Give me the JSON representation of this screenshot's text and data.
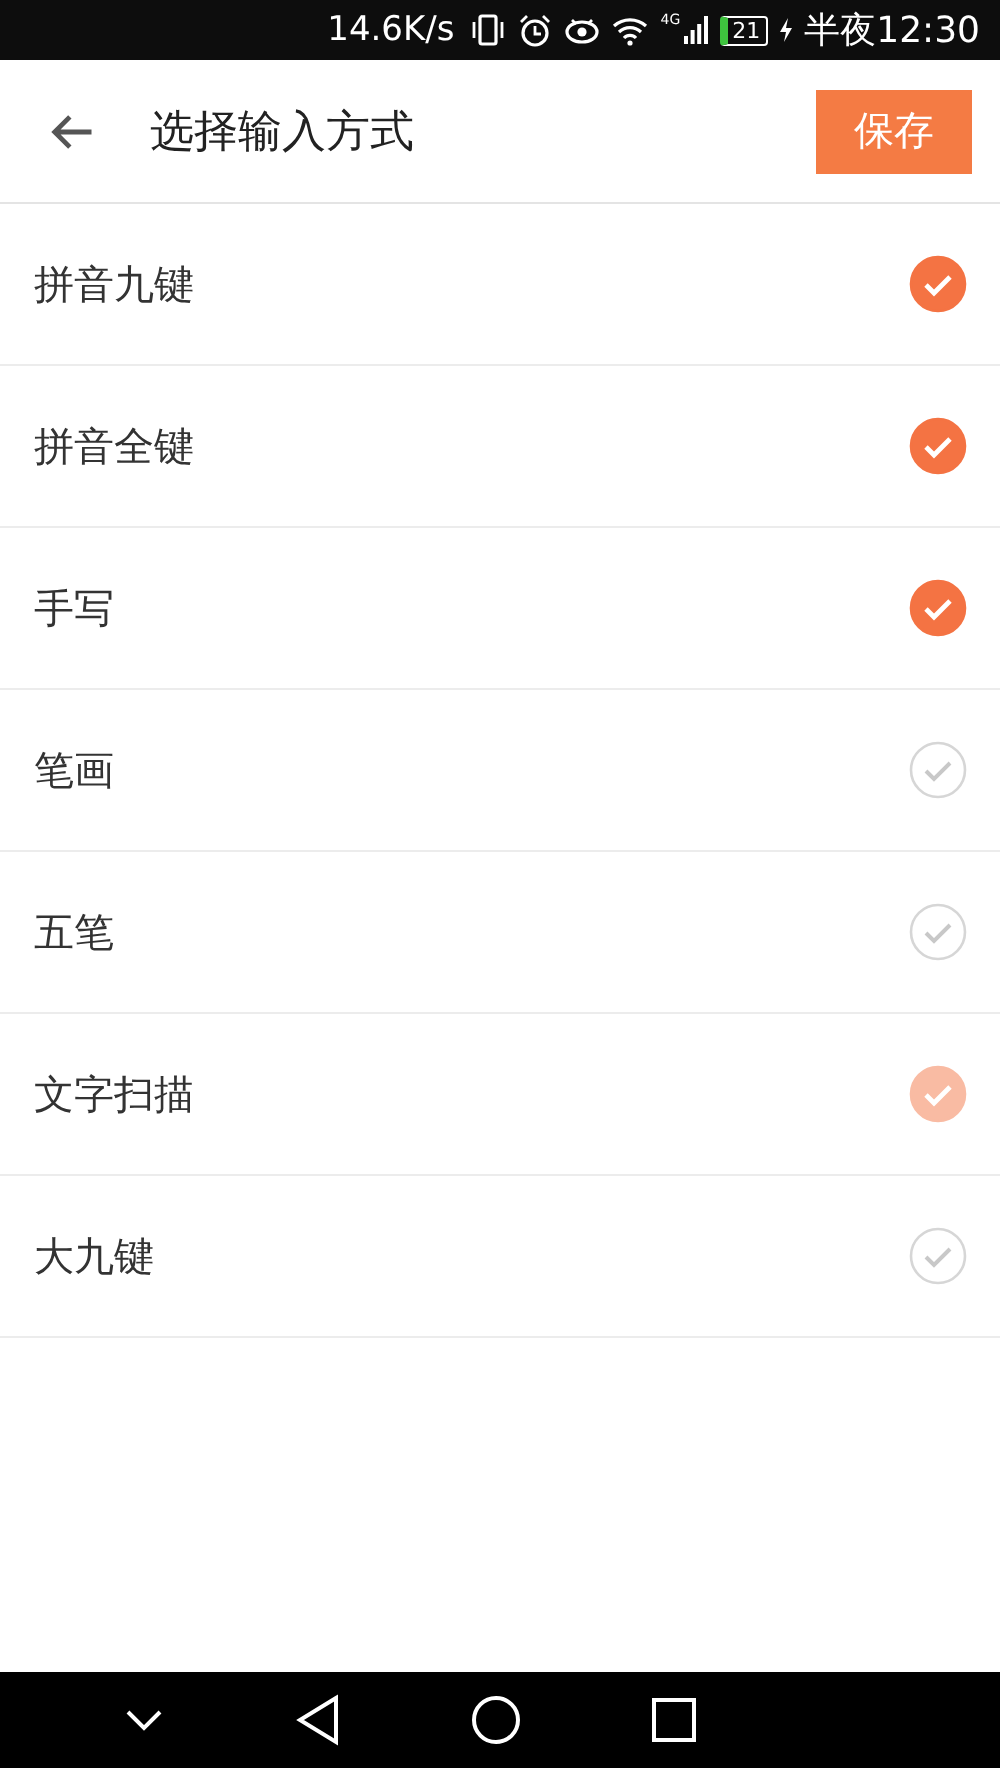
{
  "status_bar": {
    "net_speed": "14.6K/s",
    "network_type": "4G",
    "battery": "21",
    "time": "半夜12:30"
  },
  "header": {
    "title": "选择输入方式",
    "save_button": "保存"
  },
  "methods": [
    {
      "label": "拼音九键",
      "checked": true,
      "disabled": false
    },
    {
      "label": "拼音全键",
      "checked": true,
      "disabled": false
    },
    {
      "label": "手写",
      "checked": true,
      "disabled": false
    },
    {
      "label": "笔画",
      "checked": false,
      "disabled": false
    },
    {
      "label": "五笔",
      "checked": false,
      "disabled": false
    },
    {
      "label": "文字扫描",
      "checked": true,
      "disabled": true
    },
    {
      "label": "大九键",
      "checked": false,
      "disabled": false
    }
  ]
}
